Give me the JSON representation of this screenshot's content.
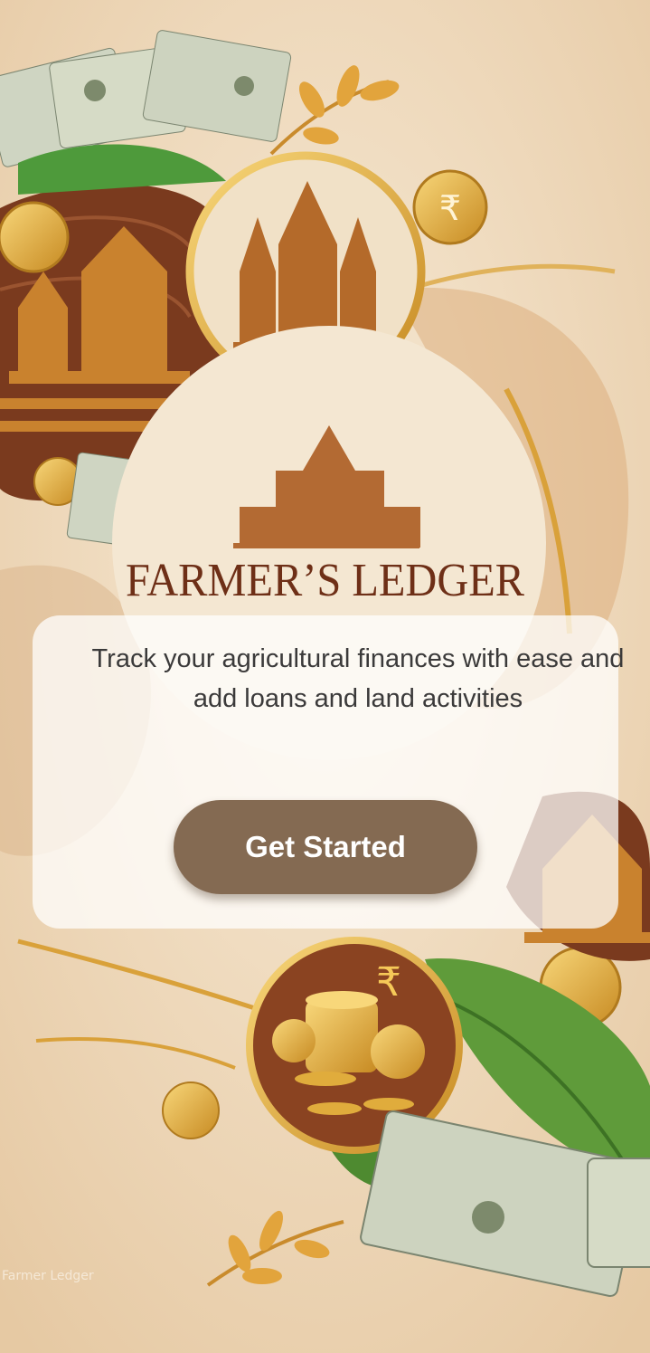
{
  "app": {
    "logo_text": "FARMER’S LEDGER",
    "tagline": "Track your agricultural finances with ease and add loans and land activities",
    "cta_label": "Get Started",
    "watermark": "Farmer Ledger"
  },
  "colors": {
    "background": "#efdcc0",
    "brown": "#6e2f17",
    "gold": "#d9a13a",
    "button": "#846a52",
    "leaf": "#5f9b3a"
  },
  "icons": [
    "temple-icon",
    "rupee-coin-icon",
    "banknote-icon",
    "leaf-icon",
    "coin-stack-icon"
  ]
}
